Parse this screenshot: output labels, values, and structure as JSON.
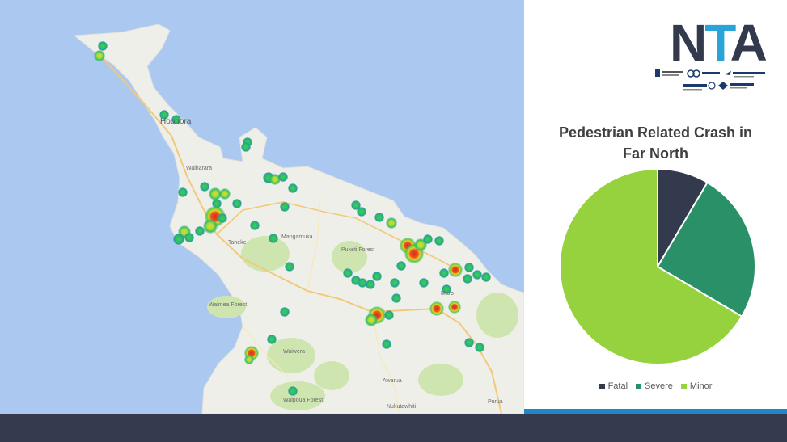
{
  "map": {
    "labels": [
      "Houhora",
      "Waiharara",
      "Mangamuka",
      "Taheke",
      "Puketi Forest",
      "Waimea Forest",
      "Waipoua Forest",
      "Awarua",
      "Nukutawhiti",
      "Purua",
      "Waiwera",
      "Maro"
    ],
    "big_label": "Houhora",
    "colors": {
      "sea": "#aac8f0",
      "land": "#efefe9",
      "park": "#cfe5b0",
      "road_major": "#f2c97a",
      "road_minor": "#f6f0cc"
    }
  },
  "logo": {
    "text_n": "N",
    "text_t": "T",
    "text_a": "A",
    "partners": [
      "Far North District Council",
      "Kaipara District Council",
      "Whangarei District Council",
      "Northland Regional Council",
      "Waka Kotahi"
    ]
  },
  "chart_data": {
    "type": "pie",
    "title_lines": [
      "Pedestrian Related Crash in",
      "Far North"
    ],
    "categories": [
      "Fatal",
      "Severe",
      "Minor"
    ],
    "values": [
      8.5,
      25,
      66.5
    ],
    "colors": [
      "#333a4d",
      "#2a9068",
      "#96d13e"
    ],
    "start_angle": 0,
    "direction": "clockwise",
    "legend_position": "bottom"
  }
}
